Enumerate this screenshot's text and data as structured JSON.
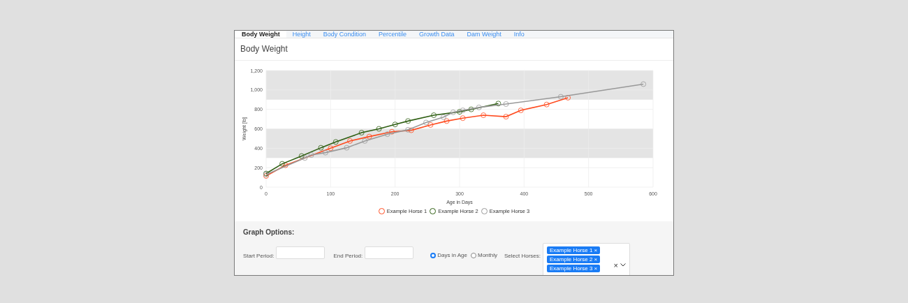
{
  "tabs": [
    {
      "label": "Body Weight",
      "selected": true
    },
    {
      "label": "Height",
      "selected": false
    },
    {
      "label": "Body Condition",
      "selected": false
    },
    {
      "label": "Percentile",
      "selected": false
    },
    {
      "label": "Growth Data",
      "selected": false
    },
    {
      "label": "Dam Weight",
      "selected": false
    },
    {
      "label": "Info",
      "selected": false
    }
  ],
  "heading": "Body Weight",
  "chart": {
    "chart_data": {
      "type": "line",
      "xlabel": "Age in Days",
      "ylabel": "Weight [lb]",
      "xlim": [
        0,
        600
      ],
      "ylim": [
        0,
        1200
      ],
      "xticks": [
        0,
        100,
        200,
        300,
        400,
        500,
        600
      ],
      "yticks": [
        0,
        200,
        400,
        600,
        800,
        {
          "value": 1000,
          "label": "1,000"
        },
        {
          "value": 1200,
          "label": "1,200"
        }
      ],
      "grid": true,
      "bands": [
        {
          "axis": "y",
          "from": 300,
          "to": 600
        },
        {
          "axis": "y",
          "from": 900,
          "to": 1200
        }
      ],
      "series": [
        {
          "name": "Example Horse 1",
          "color": "#ff4b1f",
          "marker": "circle",
          "x": [
            0,
            30,
            100,
            130,
            160,
            195,
            225,
            255,
            280,
            305,
            337,
            372,
            395,
            435,
            468
          ],
          "values": [
            115,
            225,
            400,
            475,
            520,
            570,
            585,
            640,
            680,
            710,
            740,
            725,
            790,
            850,
            920
          ]
        },
        {
          "name": "Example Horse 2",
          "color": "#2e5e12",
          "marker": "circle",
          "x": [
            0,
            25,
            55,
            85,
            108,
            148,
            175,
            200,
            220,
            260,
            300,
            318,
            360
          ],
          "values": [
            140,
            240,
            320,
            405,
            465,
            560,
            600,
            645,
            680,
            740,
            775,
            800,
            860
          ]
        },
        {
          "name": "Example Horse 3",
          "color": "#999999",
          "marker": "circle",
          "x": [
            0,
            60,
            70,
            92,
            125,
            153,
            188,
            220,
            248,
            275,
            290,
            305,
            330,
            372,
            457,
            585
          ],
          "values": [
            130,
            300,
            330,
            355,
            405,
            475,
            545,
            590,
            665,
            720,
            770,
            790,
            820,
            855,
            930,
            1060
          ]
        }
      ]
    }
  },
  "graph_options": {
    "title": "Graph Options:",
    "start_period": {
      "label": "Start Period:"
    },
    "end_period": {
      "label": "End Period:"
    },
    "view_modes": [
      {
        "label": "Days in Age",
        "selected": true
      },
      {
        "label": "Monthly",
        "selected": false
      }
    ],
    "select_horses": {
      "label": "Select Horses:",
      "tags": [
        "Example Horse 1",
        "Example Horse 2",
        "Example Horse 3"
      ],
      "tag_remove": "×",
      "clear": "×"
    }
  }
}
